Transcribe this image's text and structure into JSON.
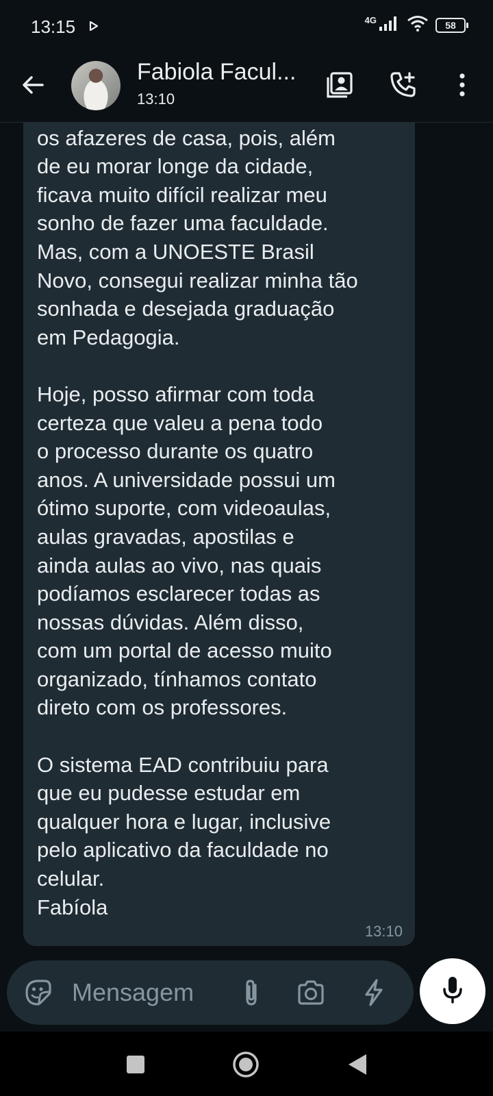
{
  "status_bar": {
    "time": "13:15",
    "network": "4G",
    "battery": "58"
  },
  "header": {
    "contact_name": "Fabiola Facul...",
    "last_seen": "13:10"
  },
  "message": {
    "text": "conseguir conciliar o trabalho com\nos afazeres de casa, pois, além\nde eu morar longe da cidade,\nficava muito difícil realizar meu\nsonho de fazer uma faculdade.\nMas, com a UNOESTE Brasil\nNovo, consegui realizar minha tão\nsonhada e desejada graduação\nem Pedagogia.\n\nHoje, posso afirmar com toda\ncerteza que valeu a pena todo\no processo durante os quatro\nanos. A universidade possui um\nótimo suporte, com videoaulas,\naulas gravadas, apostilas e\nainda aulas ao vivo, nas quais\npodíamos esclarecer todas as\nnossas dúvidas. Além disso,\ncom um portal de acesso muito\norganizado, tínhamos contato\ndireto com os professores.\n\nO sistema EAD contribuiu para\nque eu pudesse estudar em\nqualquer hora e lugar, inclusive\npelo aplicativo da faculdade no\ncelular.\nFabíola",
    "time": "13:10"
  },
  "composer": {
    "placeholder": "Mensagem"
  },
  "icons": {
    "back": "arrow-left-icon",
    "contacts": "contact-book-icon",
    "add_call": "phone-add-icon",
    "menu": "more-vert-icon",
    "sticker": "sticker-icon",
    "attach": "paperclip-icon",
    "camera": "camera-icon",
    "quick": "lightning-icon",
    "mic": "mic-icon"
  },
  "colors": {
    "background": "#0b1014",
    "bubble": "#202c33",
    "composer": "#1f2c33",
    "text": "#e9edef",
    "muted": "#8696a0"
  }
}
